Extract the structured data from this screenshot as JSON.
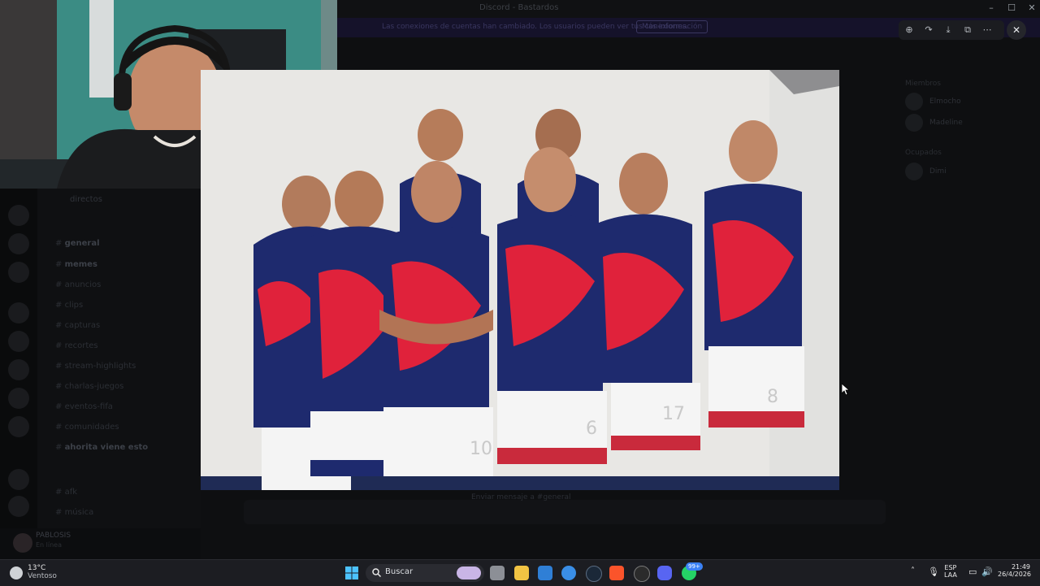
{
  "window": {
    "title": "Discord - Bastardos",
    "controls": [
      "–",
      "☐",
      "✕"
    ]
  },
  "banner": {
    "text": "Las conexiones de cuentas han cambiado. Los usuarios pueden ver tus conexiones.",
    "button": "Más información"
  },
  "channels": {
    "header": "directos",
    "items": [
      "general",
      "memes",
      "anuncios",
      "clips",
      "capturas",
      "recortes",
      "stream-highlights",
      "charlas-juegos",
      "eventos-fifa",
      "comunidades",
      "ahorita viene esto",
      "afk",
      "música"
    ]
  },
  "user": {
    "name": "PABLOSIS",
    "status": "En línea"
  },
  "members": {
    "section1": "Miembros",
    "m1": "Elmocho",
    "m2": "Madeline",
    "section2": "Ocupados",
    "m3": "Dimi"
  },
  "chat": {
    "placeholder": "Enviar mensaje a #general"
  },
  "viewer": {
    "tools": [
      "zoom-icon",
      "forward-icon",
      "download-icon",
      "open-external-icon",
      "more-icon"
    ],
    "close": "✕"
  },
  "photo": {
    "numbers": [
      "10",
      "6",
      "17",
      "8"
    ]
  },
  "taskbar": {
    "temp": "13°C",
    "weather": "Ventoso",
    "search_placeholder": "Buscar",
    "badge": "99+",
    "lang_top": "ESP",
    "lang_bottom": "LAA",
    "time": "21:49",
    "date": "26/4/2026"
  }
}
